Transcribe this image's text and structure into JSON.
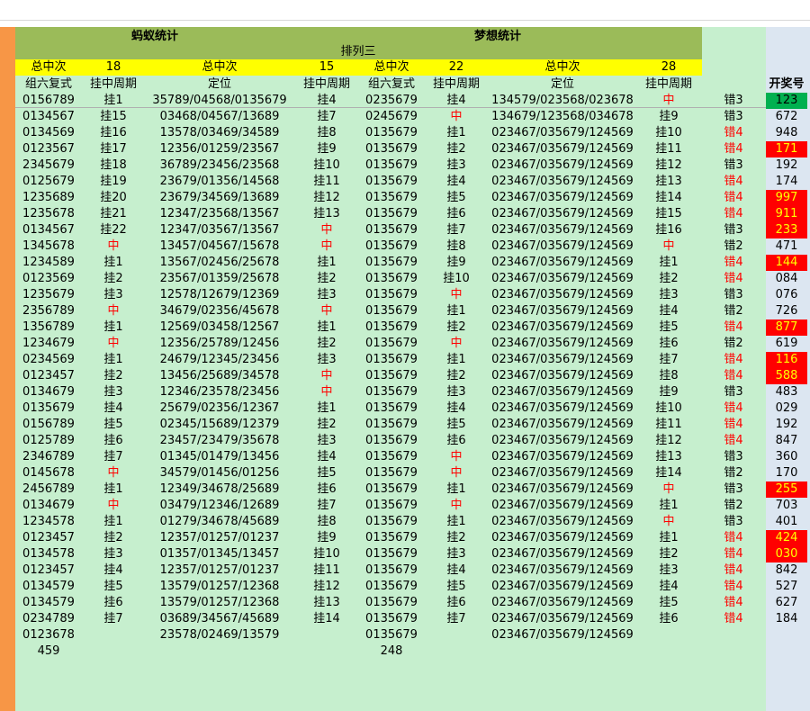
{
  "headers": {
    "left_title": "蚂蚁统计",
    "right_title": "梦想统计",
    "sub_title": "排列三",
    "total_label": "总中次",
    "left_total_1": "18",
    "left_total_2": "15",
    "right_total_1": "22",
    "right_total_2": "28",
    "col_group6": "组六复式",
    "col_period": "挂中周期",
    "col_position": "定位",
    "col_draw": "开奖号"
  },
  "rows": [
    {
      "a": "0156789",
      "b": "挂1",
      "c": "35789/04568/0135679",
      "d": "挂4",
      "e": "0235679",
      "f": "挂4",
      "g": "134579/023568/023678",
      "h": "中",
      "i": "错3",
      "j": "123",
      "jc": "green"
    },
    {
      "a": "0134567",
      "b": "挂15",
      "c": "03468/04567/13689",
      "d": "挂7",
      "e": "0245679",
      "f": "中",
      "g": "134679/123568/034678",
      "h": "挂9",
      "i": "错3",
      "j": "672",
      "jc": ""
    },
    {
      "a": "0134569",
      "b": "挂16",
      "c": "13578/03469/34589",
      "d": "挂8",
      "e": "0135679",
      "f": "挂1",
      "g": "023467/035679/124569",
      "h": "挂10",
      "i": "错4",
      "j": "948",
      "jc": ""
    },
    {
      "a": "0123567",
      "b": "挂17",
      "c": "12356/01259/23567",
      "d": "挂9",
      "e": "0135679",
      "f": "挂2",
      "g": "023467/035679/124569",
      "h": "挂11",
      "i": "错4",
      "j": "171",
      "jc": "red"
    },
    {
      "a": "2345679",
      "b": "挂18",
      "c": "36789/23456/23568",
      "d": "挂10",
      "e": "0135679",
      "f": "挂3",
      "g": "023467/035679/124569",
      "h": "挂12",
      "i": "错3",
      "j": "192",
      "jc": ""
    },
    {
      "a": "0125679",
      "b": "挂19",
      "c": "23679/01356/14568",
      "d": "挂11",
      "e": "0135679",
      "f": "挂4",
      "g": "023467/035679/124569",
      "h": "挂13",
      "i": "错4",
      "j": "174",
      "jc": ""
    },
    {
      "a": "1235689",
      "b": "挂20",
      "c": "23679/34569/13689",
      "d": "挂12",
      "e": "0135679",
      "f": "挂5",
      "g": "023467/035679/124569",
      "h": "挂14",
      "i": "错4",
      "j": "997",
      "jc": "red"
    },
    {
      "a": "1235678",
      "b": "挂21",
      "c": "12347/23568/13567",
      "d": "挂13",
      "e": "0135679",
      "f": "挂6",
      "g": "023467/035679/124569",
      "h": "挂15",
      "i": "错4",
      "j": "911",
      "jc": "red"
    },
    {
      "a": "0134567",
      "b": "挂22",
      "c": "12347/03567/13567",
      "d": "中",
      "e": "0135679",
      "f": "挂7",
      "g": "023467/035679/124569",
      "h": "挂16",
      "i": "错3",
      "j": "233",
      "jc": "red"
    },
    {
      "a": "1345678",
      "b": "中",
      "c": "13457/04567/15678",
      "d": "中",
      "e": "0135679",
      "f": "挂8",
      "g": "023467/035679/124569",
      "h": "中",
      "i": "错2",
      "j": "471",
      "jc": ""
    },
    {
      "a": "1234589",
      "b": "挂1",
      "c": "13567/02456/25678",
      "d": "挂1",
      "e": "0135679",
      "f": "挂9",
      "g": "023467/035679/124569",
      "h": "挂1",
      "i": "错4",
      "j": "144",
      "jc": "red"
    },
    {
      "a": "0123569",
      "b": "挂2",
      "c": "23567/01359/25678",
      "d": "挂2",
      "e": "0135679",
      "f": "挂10",
      "g": "023467/035679/124569",
      "h": "挂2",
      "i": "错4",
      "j": "084",
      "jc": ""
    },
    {
      "a": "1235679",
      "b": "挂3",
      "c": "12578/12679/12369",
      "d": "挂3",
      "e": "0135679",
      "f": "中",
      "g": "023467/035679/124569",
      "h": "挂3",
      "i": "错3",
      "j": "076",
      "jc": ""
    },
    {
      "a": "2356789",
      "b": "中",
      "c": "34679/02356/45678",
      "d": "中",
      "e": "0135679",
      "f": "挂1",
      "g": "023467/035679/124569",
      "h": "挂4",
      "i": "错2",
      "j": "726",
      "jc": ""
    },
    {
      "a": "1356789",
      "b": "挂1",
      "c": "12569/03458/12567",
      "d": "挂1",
      "e": "0135679",
      "f": "挂2",
      "g": "023467/035679/124569",
      "h": "挂5",
      "i": "错4",
      "j": "877",
      "jc": "red"
    },
    {
      "a": "1234679",
      "b": "中",
      "c": "12356/25789/12456",
      "d": "挂2",
      "e": "0135679",
      "f": "中",
      "g": "023467/035679/124569",
      "h": "挂6",
      "i": "错2",
      "j": "619",
      "jc": ""
    },
    {
      "a": "0234569",
      "b": "挂1",
      "c": "24679/12345/23456",
      "d": "挂3",
      "e": "0135679",
      "f": "挂1",
      "g": "023467/035679/124569",
      "h": "挂7",
      "i": "错4",
      "j": "116",
      "jc": "red"
    },
    {
      "a": "0123457",
      "b": "挂2",
      "c": "13456/25689/34578",
      "d": "中",
      "e": "0135679",
      "f": "挂2",
      "g": "023467/035679/124569",
      "h": "挂8",
      "i": "错4",
      "j": "588",
      "jc": "red"
    },
    {
      "a": "0134679",
      "b": "挂3",
      "c": "12346/23578/23456",
      "d": "中",
      "e": "0135679",
      "f": "挂3",
      "g": "023467/035679/124569",
      "h": "挂9",
      "i": "错3",
      "j": "483",
      "jc": ""
    },
    {
      "a": "0135679",
      "b": "挂4",
      "c": "25679/02356/12367",
      "d": "挂1",
      "e": "0135679",
      "f": "挂4",
      "g": "023467/035679/124569",
      "h": "挂10",
      "i": "错4",
      "j": "029",
      "jc": ""
    },
    {
      "a": "0156789",
      "b": "挂5",
      "c": "02345/15689/12379",
      "d": "挂2",
      "e": "0135679",
      "f": "挂5",
      "g": "023467/035679/124569",
      "h": "挂11",
      "i": "错4",
      "j": "192",
      "jc": ""
    },
    {
      "a": "0125789",
      "b": "挂6",
      "c": "23457/23479/35678",
      "d": "挂3",
      "e": "0135679",
      "f": "挂6",
      "g": "023467/035679/124569",
      "h": "挂12",
      "i": "错4",
      "j": "847",
      "jc": ""
    },
    {
      "a": "2346789",
      "b": "挂7",
      "c": "01345/01479/13456",
      "d": "挂4",
      "e": "0135679",
      "f": "中",
      "g": "023467/035679/124569",
      "h": "挂13",
      "i": "错3",
      "j": "360",
      "jc": ""
    },
    {
      "a": "0145678",
      "b": "中",
      "c": "34579/01456/01256",
      "d": "挂5",
      "e": "0135679",
      "f": "中",
      "g": "023467/035679/124569",
      "h": "挂14",
      "i": "错2",
      "j": "170",
      "jc": ""
    },
    {
      "a": "2456789",
      "b": "挂1",
      "c": "12349/34678/25689",
      "d": "挂6",
      "e": "0135679",
      "f": "挂1",
      "g": "023467/035679/124569",
      "h": "中",
      "i": "错3",
      "j": "255",
      "jc": "red"
    },
    {
      "a": "0134679",
      "b": "中",
      "c": "03479/12346/12689",
      "d": "挂7",
      "e": "0135679",
      "f": "中",
      "g": "023467/035679/124569",
      "h": "挂1",
      "i": "错2",
      "j": "703",
      "jc": ""
    },
    {
      "a": "1234578",
      "b": "挂1",
      "c": "01279/34678/45689",
      "d": "挂8",
      "e": "0135679",
      "f": "挂1",
      "g": "023467/035679/124569",
      "h": "中",
      "i": "错3",
      "j": "401",
      "jc": ""
    },
    {
      "a": "0123457",
      "b": "挂2",
      "c": "12357/01257/01237",
      "d": "挂9",
      "e": "0135679",
      "f": "挂2",
      "g": "023467/035679/124569",
      "h": "挂1",
      "i": "错4",
      "j": "424",
      "jc": "red"
    },
    {
      "a": "0134578",
      "b": "挂3",
      "c": "01357/01345/13457",
      "d": "挂10",
      "e": "0135679",
      "f": "挂3",
      "g": "023467/035679/124569",
      "h": "挂2",
      "i": "错4",
      "j": "030",
      "jc": "red"
    },
    {
      "a": "0123457",
      "b": "挂4",
      "c": "12357/01257/01237",
      "d": "挂11",
      "e": "0135679",
      "f": "挂4",
      "g": "023467/035679/124569",
      "h": "挂3",
      "i": "错4",
      "j": "842",
      "jc": ""
    },
    {
      "a": "0134579",
      "b": "挂5",
      "c": "13579/01257/12368",
      "d": "挂12",
      "e": "0135679",
      "f": "挂5",
      "g": "023467/035679/124569",
      "h": "挂4",
      "i": "错4",
      "j": "527",
      "jc": ""
    },
    {
      "a": "0134579",
      "b": "挂6",
      "c": "13579/01257/12368",
      "d": "挂13",
      "e": "0135679",
      "f": "挂6",
      "g": "023467/035679/124569",
      "h": "挂5",
      "i": "错4",
      "j": "627",
      "jc": ""
    },
    {
      "a": "0234789",
      "b": "挂7",
      "c": "03689/34567/45689",
      "d": "挂14",
      "e": "0135679",
      "f": "挂7",
      "g": "023467/035679/124569",
      "h": "挂6",
      "i": "错4",
      "j": "184",
      "jc": ""
    },
    {
      "a": "0123678",
      "b": "",
      "c": "23578/02469/13579",
      "d": "",
      "e": "0135679",
      "f": "",
      "g": "023467/035679/124569",
      "h": "",
      "i": "",
      "j": "",
      "jc": ""
    }
  ],
  "footer": {
    "left_count": "459",
    "right_count": "248"
  }
}
